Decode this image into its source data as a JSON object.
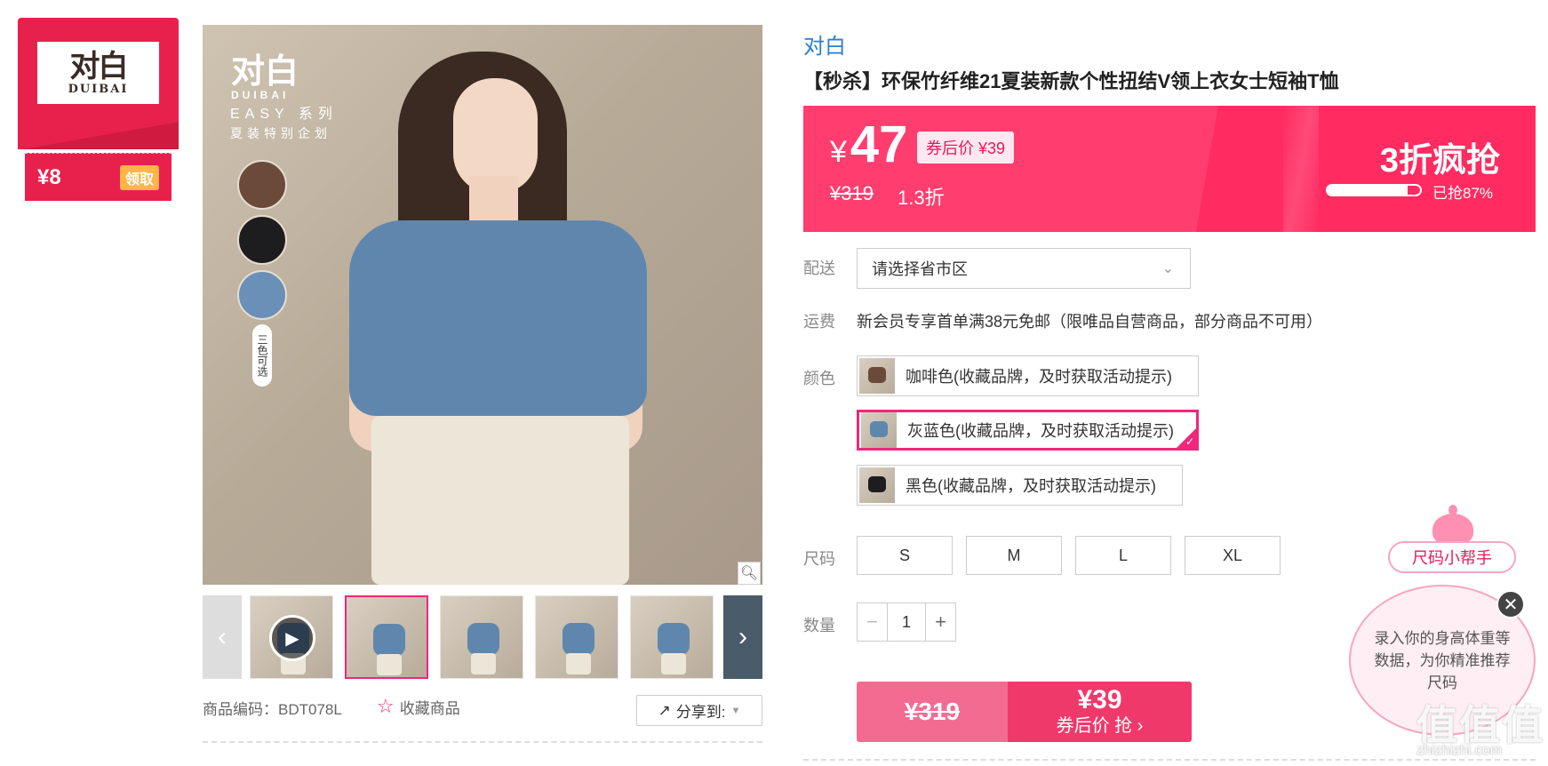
{
  "brand_card": {
    "logo_main": "对白",
    "logo_sub": "DUIBAI",
    "coupon_amount": "¥8",
    "claim_label": "领取"
  },
  "main_image": {
    "logo_main": "对白",
    "logo_sub": "DUIBAI",
    "series": "EASY 系列",
    "plan": "夏装特别企划",
    "colors_badge": "三色可选"
  },
  "gallery": {
    "thumb_count": 5,
    "active_index": 1
  },
  "below_image": {
    "product_code": "商品编码：BDT078L",
    "favorite_label": "收藏商品",
    "share_label": "分享到:"
  },
  "product": {
    "brand": "对白",
    "title": "【秒杀】环保竹纤维21夏装新款个性扭结V领上衣女士短袖T恤"
  },
  "price": {
    "currency": "¥",
    "current": "47",
    "coupon_tag": "券后价 ¥39",
    "original": "¥319",
    "discount": "1.3折",
    "flash_title": "3折疯抢",
    "sold_percent": 87,
    "sold_label": "已抢87%"
  },
  "delivery": {
    "label": "配送",
    "placeholder": "请选择省市区"
  },
  "shipping": {
    "label": "运费",
    "text": "新会员专享首单满38元免邮（限唯品自营商品，部分商品不可用）"
  },
  "colors": {
    "label": "颜色",
    "options": [
      {
        "label": "咖啡色(收藏品牌，及时获取活动提示)",
        "swatch": "#6b4a3a",
        "selected": false
      },
      {
        "label": "灰蓝色(收藏品牌，及时获取活动提示)",
        "swatch": "#5f87ae",
        "selected": true
      },
      {
        "label": "黑色(收藏品牌，及时获取活动提示)",
        "swatch": "#1d1d1f",
        "selected": false
      }
    ]
  },
  "sizes": {
    "label": "尺码",
    "options": [
      "S",
      "M",
      "L",
      "XL"
    ]
  },
  "quantity": {
    "label": "数量",
    "value": "1",
    "minus": "−",
    "plus": "+"
  },
  "buy": {
    "original": "¥319",
    "price": "¥39",
    "action": "券后价 抢 ›"
  },
  "size_helper": {
    "title": "尺码小帮手",
    "text": "录入你的身高体重等数据，为你精准推荐尺码"
  },
  "watermark": {
    "main": "值值值",
    "sub": "zhizhizhi.com"
  },
  "theme": {
    "accent": "#f0277a",
    "price_red": "#ff3d6f",
    "link_blue": "#2a7fd4"
  }
}
